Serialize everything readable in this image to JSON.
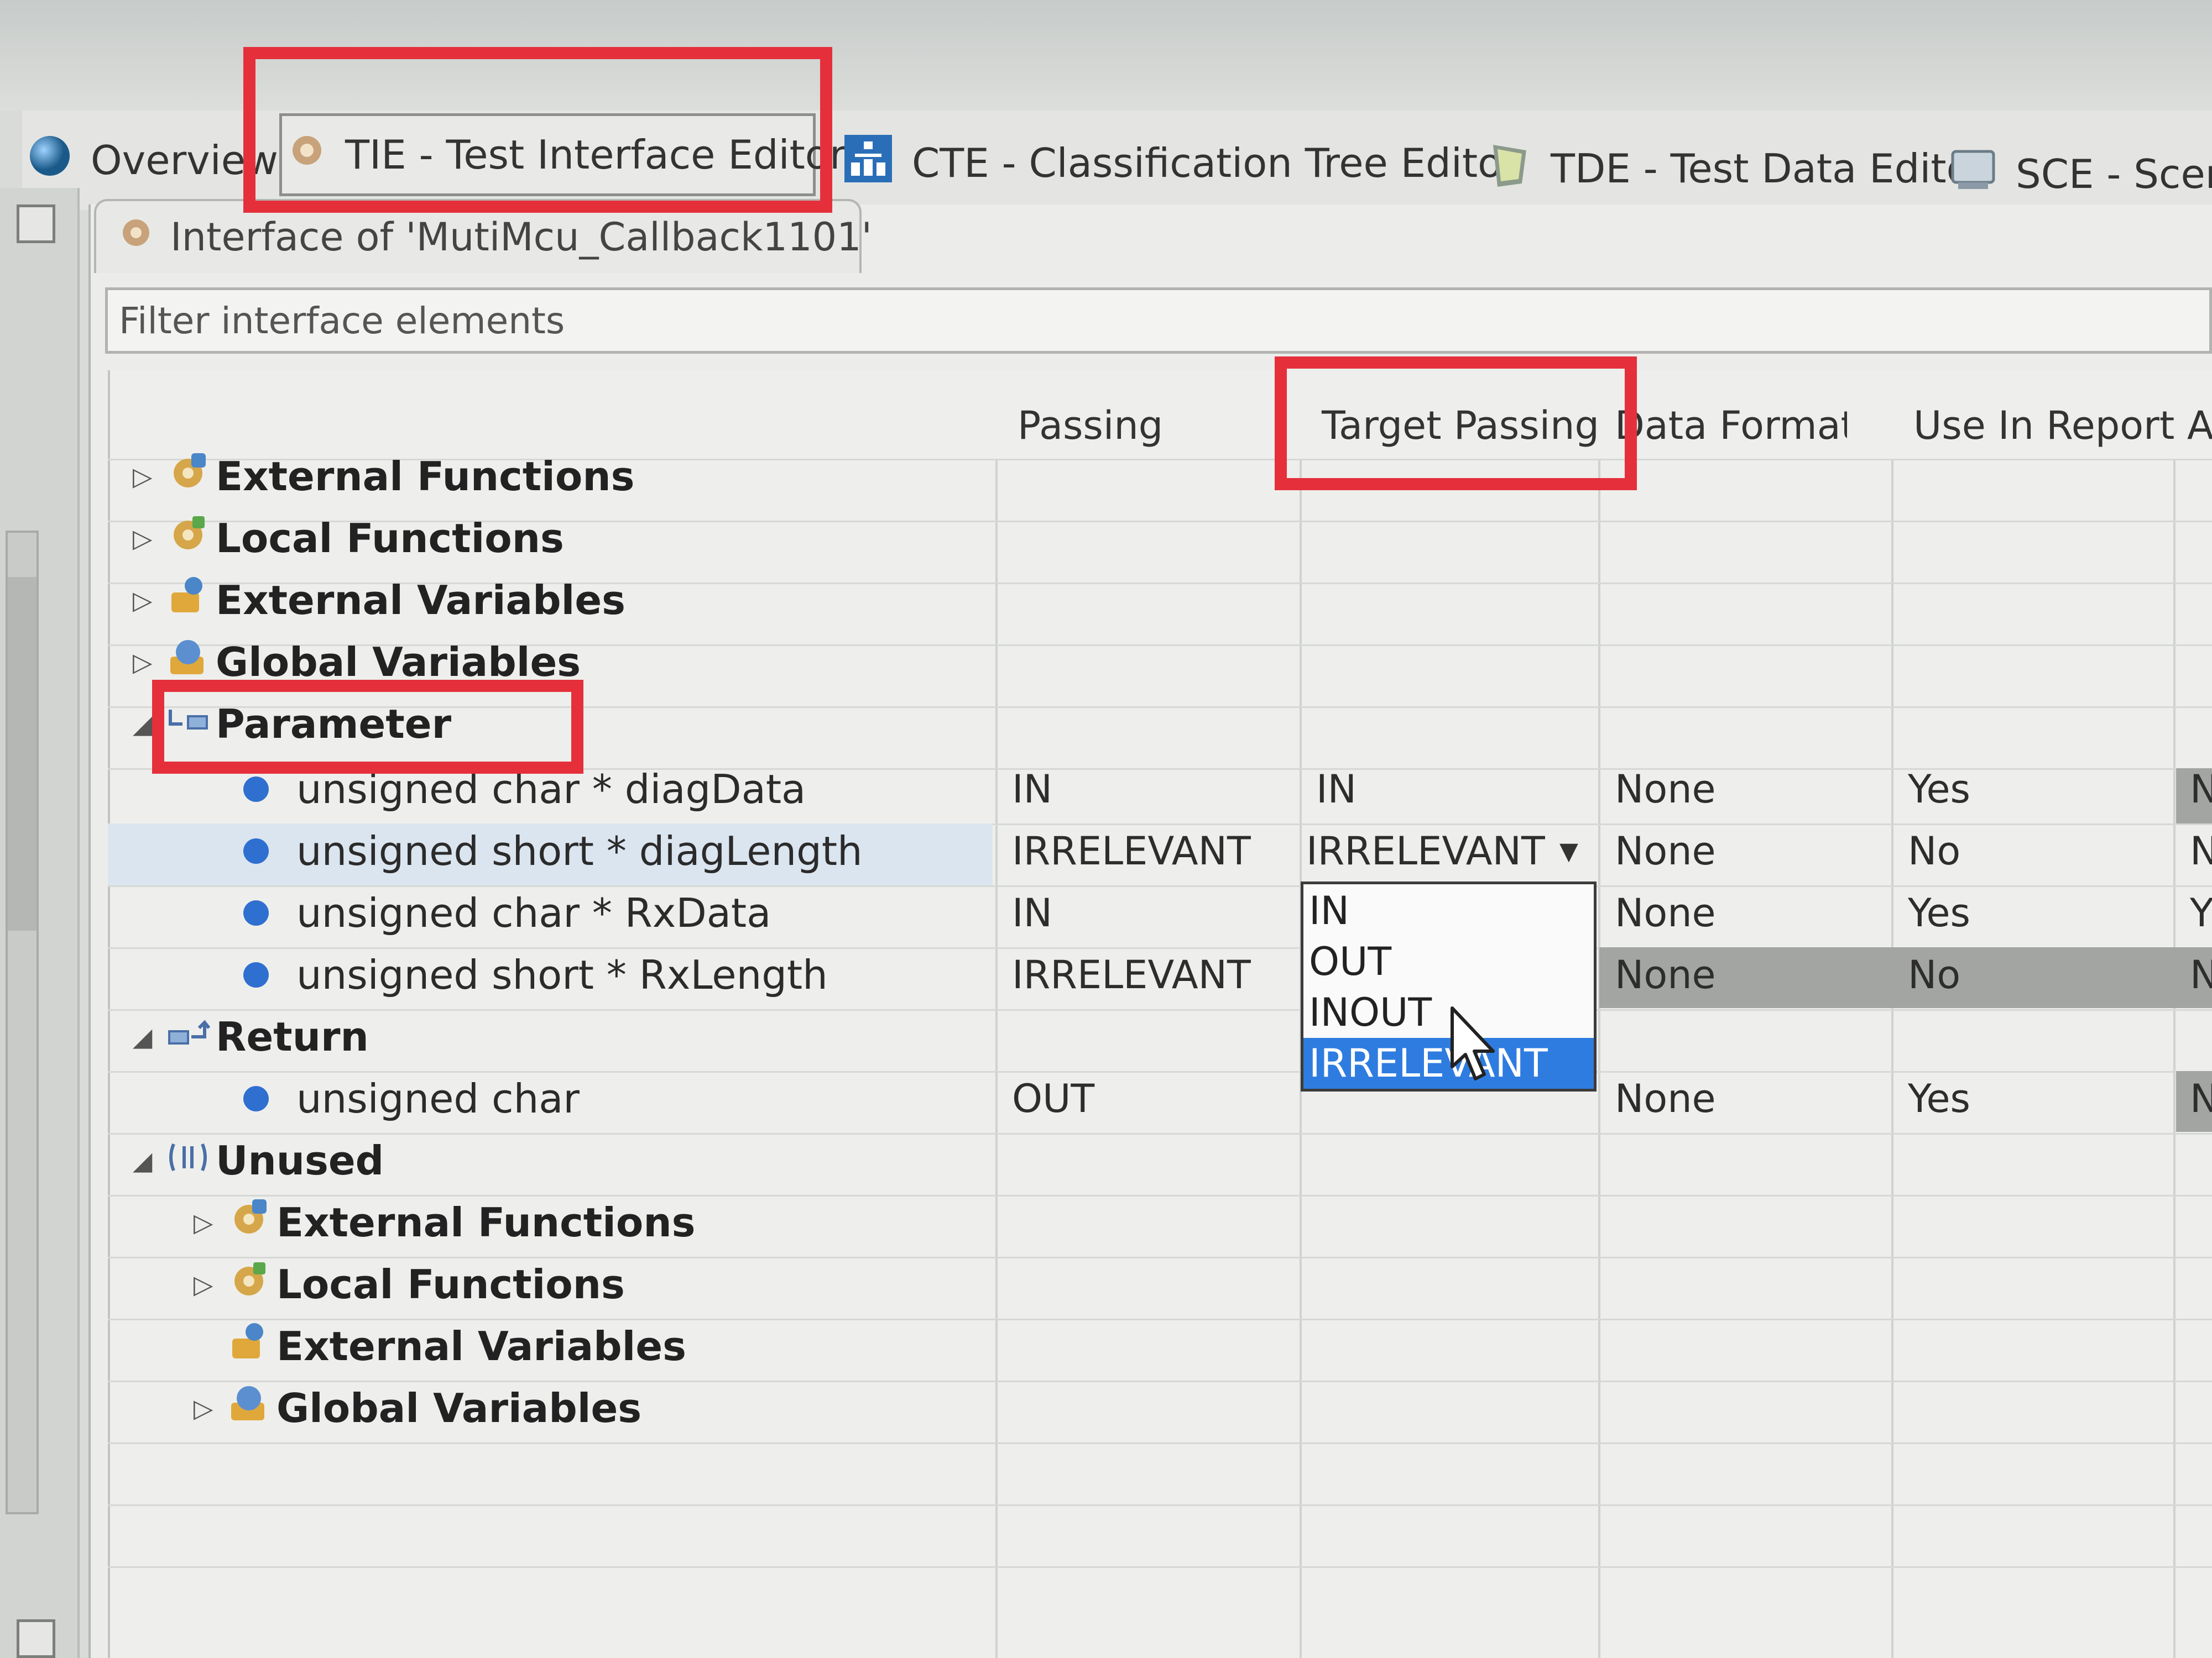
{
  "perspectives": [
    {
      "label": "Overview",
      "icon": "globe-icon"
    },
    {
      "label": "TIE - Test Interface Editor",
      "icon": "tie-icon"
    },
    {
      "label": "CTE - Classification Tree Editor",
      "icon": "tree-icon"
    },
    {
      "label": "TDE - Test Data Editor",
      "icon": "data-icon"
    },
    {
      "label": "SCE - Scenar",
      "icon": "scenario-icon"
    }
  ],
  "editor_tab": {
    "label": "Interface of 'MutiMcu_Callback1101'"
  },
  "filter": {
    "placeholder": "Filter interface elements"
  },
  "columns": {
    "passing": "Passing",
    "target_passing": "Target Passing",
    "data_format": "Data Format",
    "use_in_report": "Use In Report",
    "extra": "A"
  },
  "tree": {
    "external_functions": "External Functions",
    "local_functions": "Local Functions",
    "external_variables": "External Variables",
    "global_variables": "Global Variables",
    "parameter": "Parameter",
    "return": "Return",
    "unused": "Unused",
    "unused_external_functions": "External Functions",
    "unused_local_functions": "Local Functions",
    "unused_external_variables": "External Variables",
    "unused_global_variables": "Global Variables"
  },
  "parameters": [
    {
      "name": "unsigned char * diagData",
      "passing": "IN",
      "target": "IN",
      "format": "None",
      "report": "Yes",
      "extra": "N"
    },
    {
      "name": "unsigned short * diagLength",
      "passing": "IRRELEVANT",
      "target": "IRRELEVANT",
      "format": "None",
      "report": "No",
      "extra": "N"
    },
    {
      "name": "unsigned char * RxData",
      "passing": "IN",
      "target": "",
      "format": "None",
      "report": "Yes",
      "extra": "Y"
    },
    {
      "name": "unsigned short * RxLength",
      "passing": "IRRELEVANT",
      "target": "",
      "format": "None",
      "report": "No",
      "extra": "N"
    }
  ],
  "return_item": {
    "name": "unsigned char",
    "passing": "OUT",
    "format": "None",
    "report": "Yes",
    "extra": "N"
  },
  "dropdown": {
    "options": [
      "IN",
      "OUT",
      "INOUT",
      "IRRELEVANT"
    ],
    "selected": "IRRELEVANT"
  },
  "colors": {
    "highlight_box": "#e5303c",
    "selection": "#2e7ce0",
    "bullet": "#2f6fd0"
  }
}
